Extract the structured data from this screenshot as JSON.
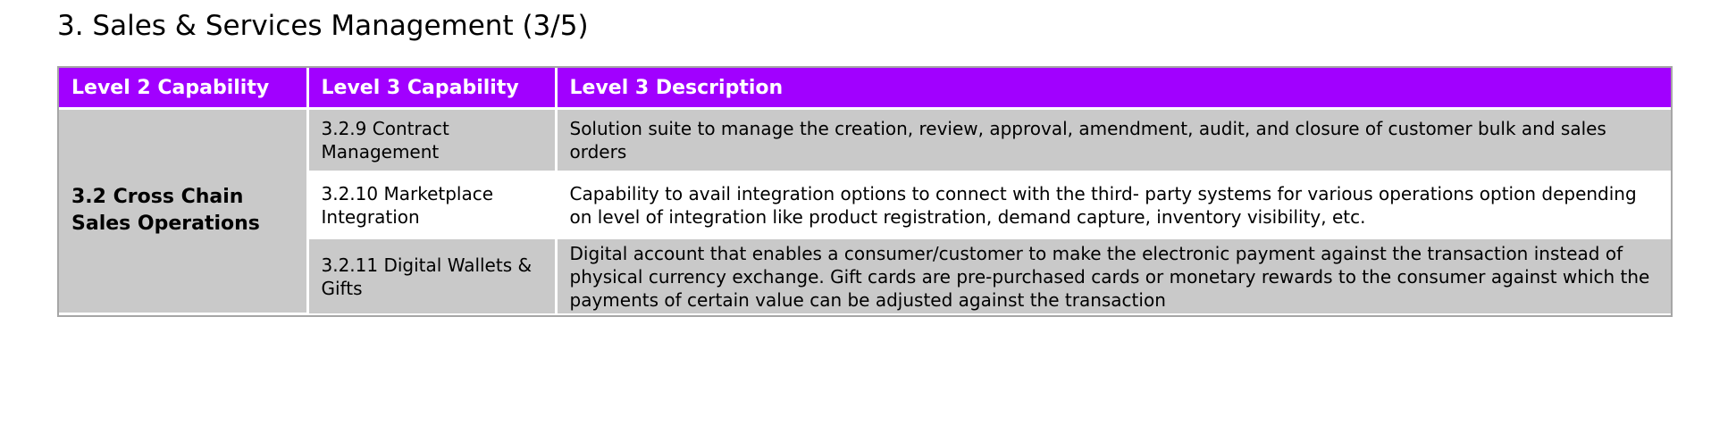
{
  "page": {
    "title": "3. Sales & Services Management (3/5)"
  },
  "colors": {
    "header_background": "#a100ff",
    "header_text": "#ffffff",
    "shaded_row": "#c9c9c9",
    "plain_row": "#ffffff",
    "table_border": "#a6a6a6"
  },
  "table": {
    "headers": [
      "Level 2 Capability",
      "Level 3 Capability",
      "Level 3 Description"
    ],
    "level2": {
      "name": "3.2 Cross Chain Sales Operations"
    },
    "rows": [
      {
        "capability": "3.2.9 Contract Management",
        "description": "Solution suite to manage the creation, review, approval, amendment, audit, and closure of customer bulk and sales orders"
      },
      {
        "capability": "3.2.10 Marketplace Integration",
        "description": "Capability to avail integration options to connect with the third- party systems for various operations option depending on level of integration like product registration, demand capture, inventory visibility, etc."
      },
      {
        "capability": "3.2.11 Digital Wallets & Gifts",
        "description": "Digital account that enables a consumer/customer to make the electronic payment against the transaction instead of physical currency exchange. Gift cards are pre-purchased cards or monetary rewards to the consumer against which the payments of certain value can be adjusted against the transaction"
      }
    ]
  }
}
